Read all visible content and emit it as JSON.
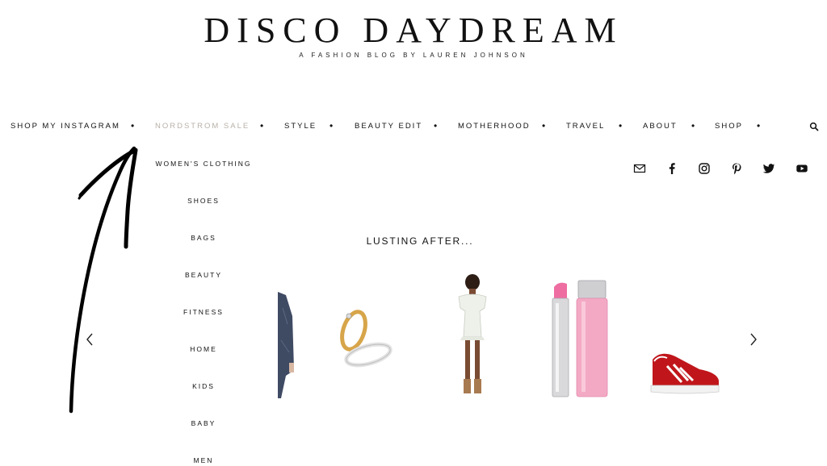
{
  "header": {
    "title": "DISCO DAYDREAM",
    "tagline": "A FASHION BLOG BY LAUREN JOHNSON"
  },
  "nav": {
    "items": [
      {
        "label": "SHOP MY INSTAGRAM"
      },
      {
        "label": "NORDSTROM SALE"
      },
      {
        "label": "STYLE"
      },
      {
        "label": "BEAUTY EDIT"
      },
      {
        "label": "MOTHERHOOD"
      },
      {
        "label": "TRAVEL"
      },
      {
        "label": "ABOUT"
      },
      {
        "label": "SHOP"
      }
    ],
    "separator": "•",
    "active_color": "#b9b1a9"
  },
  "dropdown": {
    "items": [
      "WOMEN'S CLOTHING",
      "SHOES",
      "BAGS",
      "BEAUTY",
      "FITNESS",
      "HOME",
      "KIDS",
      "BABY",
      "MEN"
    ]
  },
  "social": {
    "icons": [
      "email-icon",
      "facebook-icon",
      "instagram-icon",
      "pinterest-icon",
      "twitter-icon",
      "youtube-icon"
    ]
  },
  "carousel": {
    "title": "LUSTING AFTER...",
    "products": [
      "pajama-shirt",
      "gold-rings",
      "white-ruffle-dress",
      "pink-lip-glow",
      "red-sneaker"
    ]
  },
  "colors": {
    "text": "#111111",
    "active_nav": "#b9b1a9",
    "sneaker_red": "#c0161b",
    "lip_pink": "#f3a9c4"
  }
}
